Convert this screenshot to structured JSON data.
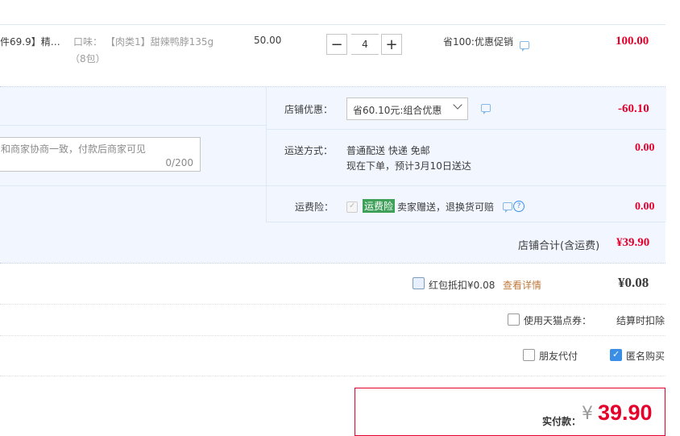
{
  "item": {
    "title_fragment": "件69.9】精…",
    "flavor_label": "口味：",
    "flavor_value": "【肉类1】甜辣鸭脖135g",
    "flavor_pack": "（8包）",
    "unit_price": "50.00",
    "quantity": "4",
    "minus": "−",
    "plus": "+",
    "promo": "省100:优惠促销",
    "subtotal": "100.00"
  },
  "shop_discount": {
    "label": "店铺优惠：",
    "select_value": "省60.10元:组合优惠",
    "amount": "-60.10"
  },
  "message": {
    "placeholder_fragment": "和商家协商一致，付款后商家可见",
    "counter": "0/200"
  },
  "shipping": {
    "label": "运送方式：",
    "method": "普通配送 快递 免邮",
    "eta": "现在下单，预计3月10日送达",
    "amount": "0.00"
  },
  "freight_insurance": {
    "label": "运费险：",
    "badge": "运费险",
    "desc": "卖家赠送，退换货可赔",
    "amount": "0.00"
  },
  "shop_total": {
    "label": "店铺合计(含运费)",
    "amount": "¥39.90"
  },
  "red_packet": {
    "label": "红包抵扣¥0.08",
    "link": "查看详情",
    "amount": "¥0.08"
  },
  "tmall_points": {
    "label": "使用天猫点券：",
    "note": "结算时扣除"
  },
  "options": {
    "friend_pay": "朋友代付",
    "anonymous": "匿名购买"
  },
  "payment": {
    "label": "实付款：",
    "currency": "¥",
    "amount": "39.90"
  },
  "colors": {
    "accent_red": "#e4002b",
    "link_orange": "#c07a3c",
    "badge_green": "#3fa05a",
    "panel_blue": "#f2f7ff"
  }
}
